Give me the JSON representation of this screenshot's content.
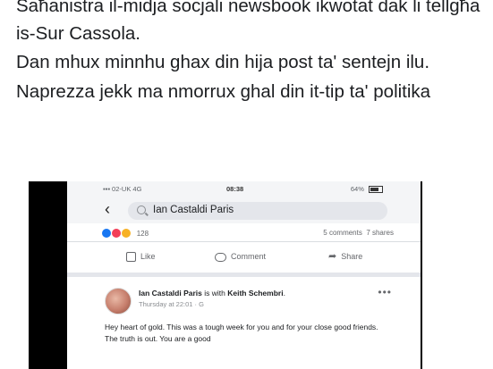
{
  "post": {
    "lines": [
      "Saħanistra il-midja soċjali newsbook ikwotat dak li tellgħa is-Sur Cassola.",
      "Dan mhux minnhu ghax din hija post ta' sentejn ilu.",
      "Naprezza jekk ma nmorrux ghal din it-tip ta' politika"
    ]
  },
  "screenshot": {
    "status": {
      "carrier": "▪▪▪ 02-UK 4G",
      "time": "08:38",
      "battery": "64%"
    },
    "search": {
      "back": "‹",
      "query": "Ian Castaldi Paris"
    },
    "stats": {
      "reactions_count": "128",
      "comments": "5 comments",
      "shares": "7 shares"
    },
    "actions": {
      "like": "Like",
      "comment": "Comment",
      "share": "Share"
    },
    "post": {
      "author": "Ian Castaldi Paris",
      "with_text": " is with ",
      "tagged": "Keith Schembri",
      "meta": "Thursday at 22:01 · G",
      "more": "•••",
      "body": "Hey heart of gold. This was a tough week for you and for your close good friends. The truth is out. You are a good"
    }
  },
  "colors": {
    "facebook_blue": "#1877f2",
    "text": "#1c1e21",
    "muted": "#65676b"
  }
}
